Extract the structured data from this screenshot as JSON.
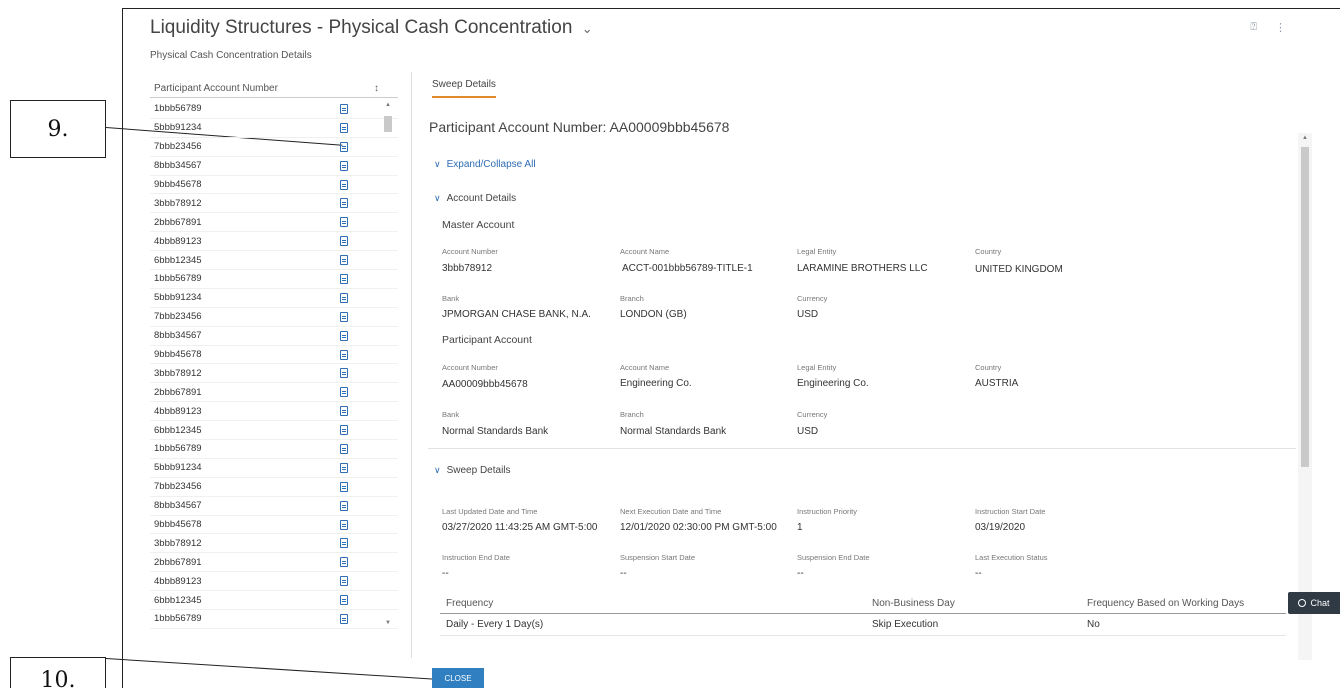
{
  "callouts": {
    "nine": "9.",
    "ten": "10."
  },
  "header": {
    "title": "Liquidity Structures - Physical Cash Concentration",
    "title_chevron": "⌄",
    "subtitle": "Physical Cash Concentration Details",
    "help_icon": "⍰",
    "more_icon": "⋮"
  },
  "left": {
    "column_header": "Participant Account Number",
    "sort_icon": "↕",
    "accounts": [
      "1bbb56789",
      "5bbb91234",
      "7bbb23456",
      "8bbb34567",
      "9bbb45678",
      "3bbb78912",
      "2bbb67891",
      "4bbb89123",
      "6bbb12345",
      "1bbb56789",
      "5bbb91234",
      "7bbb23456",
      "8bbb34567",
      "9bbb45678",
      "3bbb78912",
      "2bbb67891",
      "4bbb89123",
      "6bbb12345",
      "1bbb56789",
      "5bbb91234",
      "7bbb23456",
      "8bbb34567",
      "9bbb45678",
      "3bbb78912",
      "2bbb67891",
      "4bbb89123",
      "6bbb12345",
      "1bbb56789"
    ]
  },
  "right": {
    "tab": "Sweep Details",
    "participant_label": "Participant Account Number:",
    "participant_value": "AA00009bbb45678",
    "expand_all": "Expand/Collapse All",
    "account_details": "Account Details",
    "master_account": "Master Account",
    "participant_account": "Participant Account",
    "sweep_details": "Sweep Details",
    "labels": {
      "account_number": "Account Number",
      "account_name": "Account Name",
      "legal_entity": "Legal Entity",
      "country": "Country",
      "bank": "Bank",
      "branch": "Branch",
      "currency": "Currency",
      "last_updated": "Last Updated Date and Time",
      "next_execution": "Next Execution Date and Time",
      "instruction_priority": "Instruction Priority",
      "instruction_start": "Instruction Start Date",
      "instruction_end": "Instruction End Date",
      "suspension_start": "Suspension Start Date",
      "suspension_end": "Suspension End Date",
      "last_execution_status": "Last Execution Status"
    },
    "master": {
      "account_number": "3bbb78912",
      "account_name": "ACCT-001bbb56789-TITLE-1",
      "legal_entity": "LARAMINE BROTHERS LLC",
      "country": "UNITED KINGDOM",
      "bank": "JPMORGAN CHASE BANK, N.A.",
      "branch": "LONDON (GB)",
      "currency": "USD"
    },
    "participant": {
      "account_number": "AA00009bbb45678",
      "account_name": "Engineering Co.",
      "legal_entity": "Engineering Co.",
      "country": "AUSTRIA",
      "bank": "Normal Standards Bank",
      "branch": "Normal Standards Bank",
      "currency": "USD"
    },
    "sweep": {
      "last_updated": "03/27/2020 11:43:25 AM GMT-5:00",
      "next_execution": "12/01/2020 02:30:00 PM GMT-5:00",
      "instruction_priority": "1",
      "instruction_start": "03/19/2020",
      "instruction_end": "--",
      "suspension_start": "--",
      "suspension_end": "--",
      "last_execution_status": "--"
    },
    "frequency_table": {
      "headers": [
        "Frequency",
        "Non-Business Day",
        "Frequency Based on Working Days"
      ],
      "row": [
        "Daily - Every 1 Day(s)",
        "Skip Execution",
        "No"
      ]
    }
  },
  "chat_label": "Chat",
  "close_label": "CLOSE"
}
